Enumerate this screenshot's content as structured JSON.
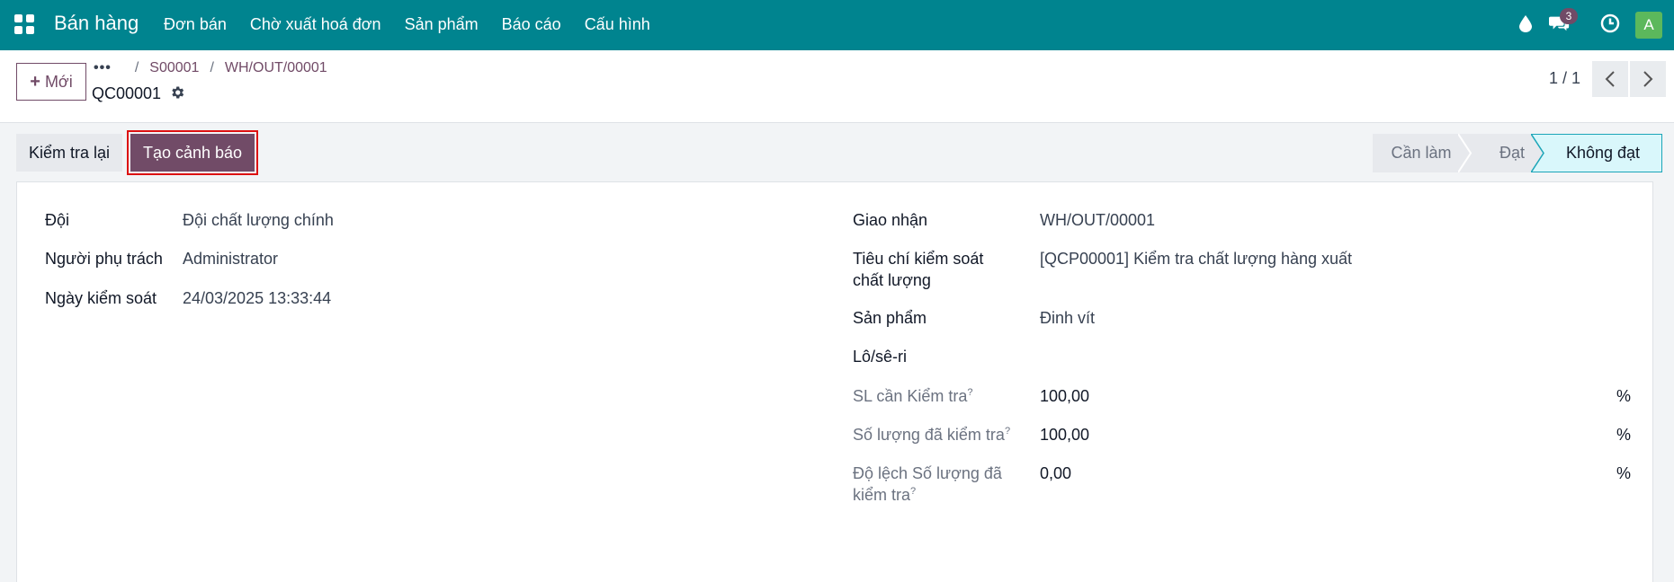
{
  "navbar": {
    "app_name": "Bán hàng",
    "menu": [
      "Đơn bán",
      "Chờ xuất hoá đơn",
      "Sản phẩm",
      "Báo cáo",
      "Cấu hình"
    ],
    "messages_badge": "3",
    "avatar_letter": "A"
  },
  "control_panel": {
    "new_button": "Mới",
    "breadcrumb_dots": "•••",
    "breadcrumb": [
      "S00001",
      "WH/OUT/00001"
    ],
    "record_title": "QC00001",
    "pager": "1 / 1"
  },
  "statusbar": {
    "recheck_button": "Kiểm tra lại",
    "alert_button": "Tạo cảnh báo",
    "stages": [
      "Cần làm",
      "Đạt",
      "Không đạt"
    ],
    "active_stage": "Không đạt"
  },
  "form": {
    "left": {
      "team_label": "Đội",
      "team_value": "Đội chất lượng chính",
      "responsible_label": "Người phụ trách",
      "responsible_value": "Administrator",
      "date_label": "Ngày kiểm soát",
      "date_value": "24/03/2025 13:33:44"
    },
    "right": {
      "picking_label": "Giao nhận",
      "picking_value": "WH/OUT/00001",
      "control_point_label_1": "Tiêu chí kiểm soát",
      "control_point_label_2": "chất lượng",
      "control_point_value": "[QCP00001] Kiểm tra chất lượng hàng xuất",
      "product_label": "Sản phẩm",
      "product_value": "Đinh vít",
      "lot_label": "Lô/sê-ri",
      "qty_to_check_label": "SL cần Kiểm tra",
      "qty_to_check_value": "100,00",
      "qty_checked_label": "Số lượng đã kiểm tra",
      "qty_checked_value": "100,00",
      "qty_dev_label_1": "Độ lệch Số lượng đã",
      "qty_dev_label_2": "kiểm tra",
      "qty_dev_value": "0,00",
      "help_mark": "?",
      "unit": "%"
    }
  },
  "colors": {
    "navbar": "#00848f",
    "primary": "#714b67",
    "active_stage": "#d9f7fb",
    "highlight_frame": "#dd1111"
  }
}
